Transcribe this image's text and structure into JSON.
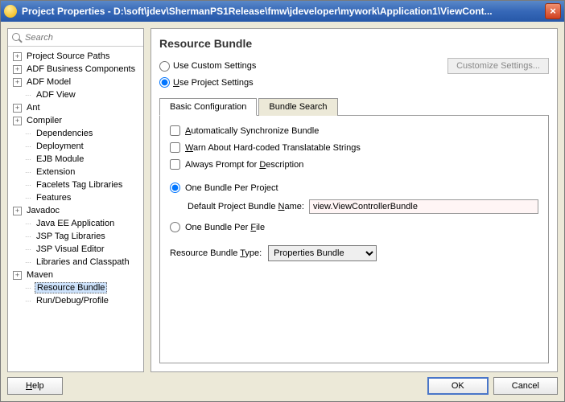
{
  "window": {
    "title": "Project Properties - D:\\soft\\jdev\\ShermanPS1Release\\fmw\\jdeveloper\\mywork\\Application1\\ViewCont..."
  },
  "search": {
    "placeholder": "Search"
  },
  "tree": {
    "items": [
      {
        "label": "Project Source Paths",
        "expandable": true
      },
      {
        "label": "ADF Business Components",
        "expandable": true
      },
      {
        "label": "ADF Model",
        "expandable": true
      },
      {
        "label": "ADF View",
        "expandable": false,
        "child": true
      },
      {
        "label": "Ant",
        "expandable": true
      },
      {
        "label": "Compiler",
        "expandable": true
      },
      {
        "label": "Dependencies",
        "expandable": false,
        "child": true
      },
      {
        "label": "Deployment",
        "expandable": false,
        "child": true
      },
      {
        "label": "EJB Module",
        "expandable": false,
        "child": true
      },
      {
        "label": "Extension",
        "expandable": false,
        "child": true
      },
      {
        "label": "Facelets Tag Libraries",
        "expandable": false,
        "child": true
      },
      {
        "label": "Features",
        "expandable": false,
        "child": true
      },
      {
        "label": "Javadoc",
        "expandable": true
      },
      {
        "label": "Java EE Application",
        "expandable": false,
        "child": true
      },
      {
        "label": "JSP Tag Libraries",
        "expandable": false,
        "child": true
      },
      {
        "label": "JSP Visual Editor",
        "expandable": false,
        "child": true
      },
      {
        "label": "Libraries and Classpath",
        "expandable": false,
        "child": true
      },
      {
        "label": "Maven",
        "expandable": true
      },
      {
        "label": "Resource Bundle",
        "expandable": false,
        "child": true,
        "selected": true
      },
      {
        "label": "Run/Debug/Profile",
        "expandable": false,
        "child": true
      }
    ]
  },
  "panel": {
    "title": "Resource Bundle",
    "useCustom": "Use Custom Settings",
    "useProject": "Use Project Settings",
    "customizeBtn": "Customize Settings...",
    "tabs": {
      "basic": "Basic Configuration",
      "search": "Bundle Search"
    },
    "checkAuto": "Automatically Synchronize Bundle",
    "checkWarn": "Warn About Hard-coded Translatable Strings",
    "checkPrompt": "Always Prompt for Description",
    "radioPerProject": "One Bundle Per Project",
    "defaultNameLabel": "Default Project Bundle Name:",
    "defaultNameValue": "view.ViewControllerBundle",
    "radioPerFile": "One Bundle Per File",
    "typeLabel": "Resource Bundle Type:",
    "typeValue": "Properties Bundle"
  },
  "buttons": {
    "help": "Help",
    "ok": "OK",
    "cancel": "Cancel"
  }
}
